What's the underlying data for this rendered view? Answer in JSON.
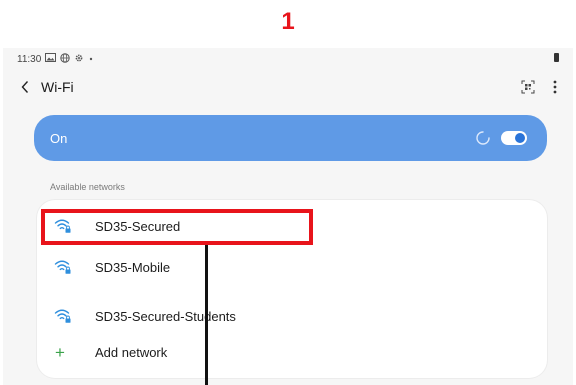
{
  "step_number": "1",
  "status_bar": {
    "time": "11:30",
    "icons": [
      "image-icon",
      "globe-icon",
      "gear-icon",
      "dot-icon",
      "battery-icon"
    ]
  },
  "header": {
    "title": "Wi-Fi",
    "back_icon": "chevron-left-icon",
    "actions": [
      "qr-code-icon",
      "more-vertical-icon"
    ]
  },
  "wifi_toggle": {
    "label": "On",
    "state": "on",
    "accent_color": "#5f9ae6",
    "switch_color": "#2a74d8"
  },
  "available_networks": {
    "section_title": "Available networks",
    "networks": [
      {
        "name": "SD35-Secured",
        "icon": "wifi-lock-icon"
      },
      {
        "name": "SD35-Mobile",
        "icon": "wifi-lock-icon"
      },
      {
        "name": "SD35-Secured-Students",
        "icon": "wifi-lock-icon"
      }
    ],
    "add_network_label": "Add network",
    "add_icon": "plus-icon"
  },
  "annotation": {
    "highlight_color": "#e8141b",
    "highlighted_item": "SD35-Secured"
  }
}
